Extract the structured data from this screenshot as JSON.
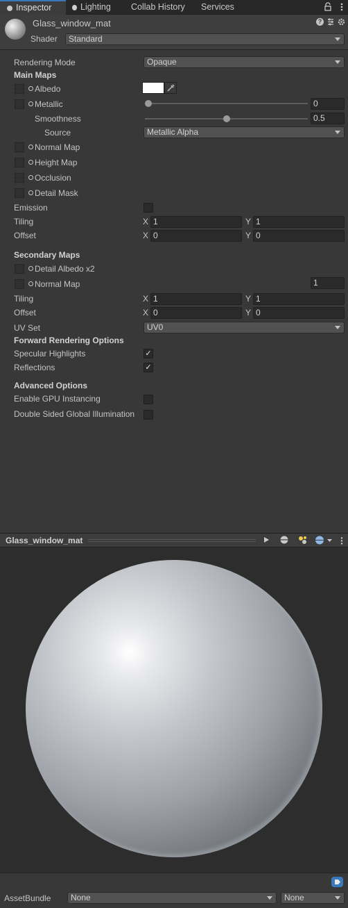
{
  "tabs": [
    {
      "label": "Inspector",
      "active": true,
      "icon": "info-icon"
    },
    {
      "label": "Lighting",
      "active": false,
      "icon": "bulb-icon"
    },
    {
      "label": "Collab History",
      "active": false
    },
    {
      "label": "Services",
      "active": false
    }
  ],
  "header": {
    "material_name": "Glass_window_mat",
    "shader_label": "Shader",
    "shader_value": "Standard"
  },
  "props": {
    "rendering_mode_label": "Rendering Mode",
    "rendering_mode_value": "Opaque",
    "main_maps": "Main Maps",
    "albedo": "Albedo",
    "albedo_color": "#ffffff",
    "metallic": "Metallic",
    "metallic_value": "0",
    "smoothness": "Smoothness",
    "smoothness_value": "0.5",
    "source": "Source",
    "source_value": "Metallic Alpha",
    "normal_map": "Normal Map",
    "height_map": "Height Map",
    "occlusion": "Occlusion",
    "detail_mask": "Detail Mask",
    "emission": "Emission",
    "tiling": "Tiling",
    "offset": "Offset",
    "tiling_x": "1",
    "tiling_y": "1",
    "offset_x": "0",
    "offset_y": "0",
    "axis_x": "X",
    "axis_y": "Y",
    "secondary_maps": "Secondary Maps",
    "detail_albedo": "Detail Albedo x2",
    "sec_normal_map": "Normal Map",
    "sec_normal_value": "1",
    "sec_tiling_x": "1",
    "sec_tiling_y": "1",
    "sec_offset_x": "0",
    "sec_offset_y": "0",
    "uv_set": "UV Set",
    "uv_set_value": "UV0",
    "forward_rendering": "Forward Rendering Options",
    "specular_highlights": "Specular Highlights",
    "reflections": "Reflections",
    "advanced_options": "Advanced Options",
    "gpu_instancing": "Enable GPU Instancing",
    "double_sided_gi": "Double Sided Global Illumination",
    "check_mark": "✓"
  },
  "slider_levels": {
    "metallic": 0.0,
    "smoothness": 0.5
  },
  "preview": {
    "title": "Glass_window_mat"
  },
  "footer": {
    "assetbundle_label": "AssetBundle",
    "bundle_value": "None",
    "variant_value": "None"
  },
  "colors": {
    "accent": "#3a79bb",
    "background": "#383838"
  }
}
